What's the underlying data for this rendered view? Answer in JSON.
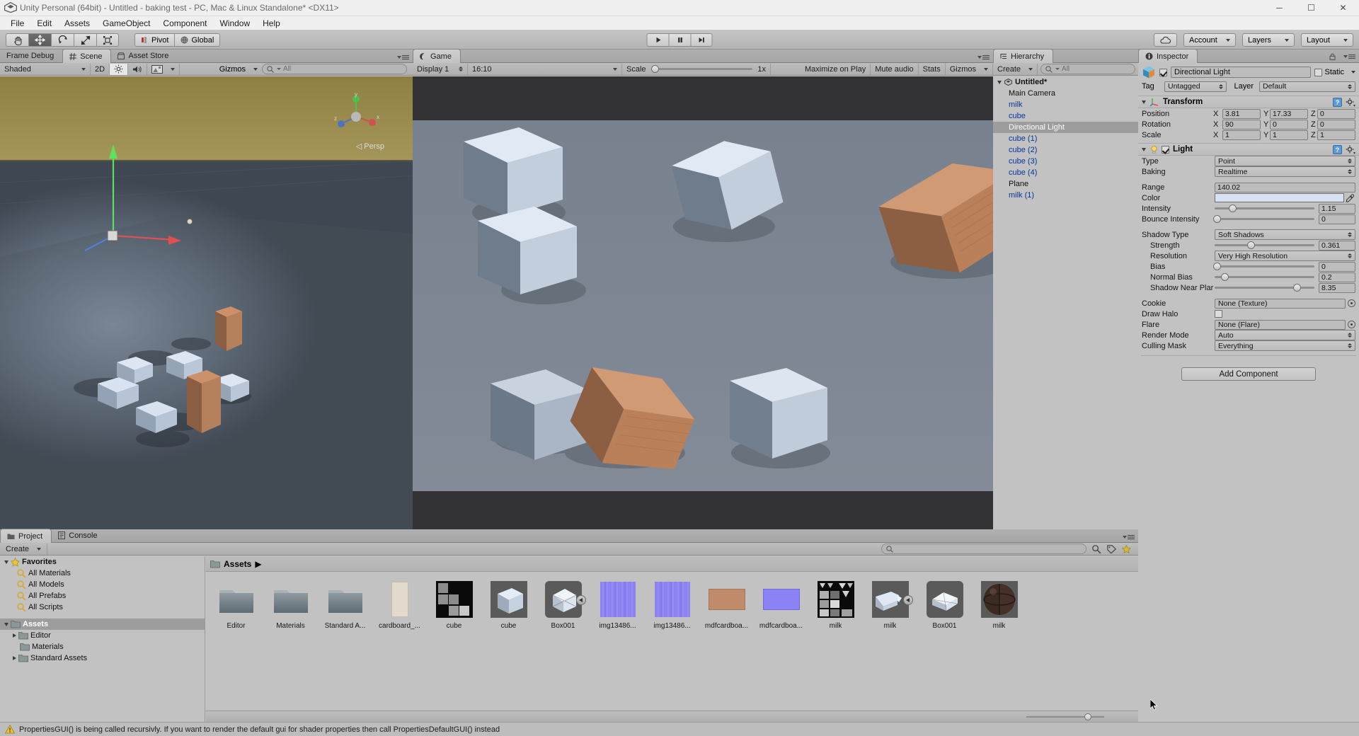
{
  "window": {
    "title": "Unity Personal (64bit) - Untitled - baking test - PC, Mac & Linux Standalone* <DX11>",
    "minimize": "─",
    "maximize": "☐",
    "close": "✕"
  },
  "menu": [
    "File",
    "Edit",
    "Assets",
    "GameObject",
    "Component",
    "Window",
    "Help"
  ],
  "toolbar": {
    "tools": [
      "hand-tool",
      "move-tool",
      "rotate-tool",
      "scale-tool",
      "rect-tool"
    ],
    "active_tool": "move-tool",
    "pivot_label": "Pivot",
    "global_label": "Global",
    "play_label": "play",
    "pause_label": "pause",
    "step_label": "step",
    "cloud_label": "cloud-icon",
    "account_label": "Account",
    "layers_label": "Layers",
    "layout_label": "Layout"
  },
  "scene_panel": {
    "tabs": [
      {
        "label": "Frame Debug",
        "active": false,
        "icon": ""
      },
      {
        "label": "Scene",
        "active": true,
        "icon": "grid-icon"
      },
      {
        "label": "Asset Store",
        "active": false,
        "icon": "store-icon"
      }
    ],
    "draw_mode": "Shaded",
    "two_d": "2D",
    "lighting_icon": "light-toggle-icon",
    "audio_icon": "audio-toggle-icon",
    "effects_icon": "effects-icon",
    "gizmos_label": "Gizmos",
    "search_placeholder": "All",
    "perspective_label": "Persp",
    "axis_labels": {
      "y": "y",
      "x": "x",
      "z": "z"
    }
  },
  "game_panel": {
    "tabs": [
      {
        "label": "Game",
        "active": true,
        "icon": "game-icon"
      }
    ],
    "display": "Display 1",
    "aspect": "16:10",
    "scale_label": "Scale",
    "scale_value": "1x",
    "maximize_label": "Maximize on Play",
    "mute_label": "Mute audio",
    "stats_label": "Stats",
    "gizmos_label": "Gizmos"
  },
  "hierarchy": {
    "tab_label": "Hierarchy",
    "create_label": "Create",
    "search_placeholder": "All",
    "scene_name": "Untitled*",
    "items": [
      {
        "label": "Main Camera",
        "type": "plain",
        "selected": false
      },
      {
        "label": "milk",
        "type": "prefab",
        "selected": false
      },
      {
        "label": "cube",
        "type": "prefab",
        "selected": false
      },
      {
        "label": "Directional Light",
        "type": "plain",
        "selected": true
      },
      {
        "label": "cube (1)",
        "type": "prefab",
        "selected": false
      },
      {
        "label": "cube (2)",
        "type": "prefab",
        "selected": false
      },
      {
        "label": "cube (3)",
        "type": "prefab",
        "selected": false
      },
      {
        "label": "cube (4)",
        "type": "prefab",
        "selected": false
      },
      {
        "label": "Plane",
        "type": "plain",
        "selected": false
      },
      {
        "label": "milk (1)",
        "type": "prefab",
        "selected": false
      }
    ]
  },
  "inspector": {
    "tab_label": "Inspector",
    "object_name": "Directional Light",
    "object_enabled": true,
    "static_label": "Static",
    "tag_label": "Tag",
    "tag_value": "Untagged",
    "layer_label": "Layer",
    "layer_value": "Default",
    "transform": {
      "title": "Transform",
      "position_label": "Position",
      "rotation_label": "Rotation",
      "scale_label": "Scale",
      "position": {
        "x": "3.81",
        "y": "17.33",
        "z": "0"
      },
      "rotation": {
        "x": "90",
        "y": "0",
        "z": "0"
      },
      "scale": {
        "x": "1",
        "y": "1",
        "z": "1"
      }
    },
    "light": {
      "title": "Light",
      "enabled": true,
      "type_label": "Type",
      "type_value": "Point",
      "baking_label": "Baking",
      "baking_value": "Realtime",
      "range_label": "Range",
      "range_value": "140.02",
      "color_label": "Color",
      "color_value": "#d8e0f4",
      "intensity_label": "Intensity",
      "intensity_value": "1.15",
      "intensity_pct": 18,
      "bounce_label": "Bounce Intensity",
      "bounce_value": "0",
      "bounce_pct": 2,
      "shadow_type_label": "Shadow Type",
      "shadow_type_value": "Soft Shadows",
      "strength_label": "Strength",
      "strength_value": "0.361",
      "strength_pct": 36,
      "resolution_label": "Resolution",
      "resolution_value": "Very High Resolution",
      "bias_label": "Bias",
      "bias_value": "0",
      "bias_pct": 2,
      "normal_bias_label": "Normal Bias",
      "normal_bias_value": "0.2",
      "normal_bias_pct": 10,
      "near_plane_label": "Shadow Near Plar",
      "near_plane_value": "8.35",
      "near_plane_pct": 82,
      "cookie_label": "Cookie",
      "cookie_value": "None (Texture)",
      "draw_halo_label": "Draw Halo",
      "draw_halo_checked": false,
      "flare_label": "Flare",
      "flare_value": "None (Flare)",
      "render_mode_label": "Render Mode",
      "render_mode_value": "Auto",
      "culling_label": "Culling Mask",
      "culling_value": "Everything"
    },
    "add_component_label": "Add Component"
  },
  "project": {
    "tabs": [
      {
        "label": "Project",
        "active": true,
        "icon": "folder-icon"
      },
      {
        "label": "Console",
        "active": false,
        "icon": "console-icon"
      }
    ],
    "create_label": "Create",
    "search_placeholder": "",
    "breadcrumb": "Assets",
    "tree": [
      {
        "label": "Favorites",
        "depth": 0,
        "bold": true,
        "arrow": "down",
        "icon": "star-icon",
        "selected": false
      },
      {
        "label": "All Materials",
        "depth": 1,
        "bold": false,
        "arrow": "none",
        "icon": "search-icon",
        "selected": false
      },
      {
        "label": "All Models",
        "depth": 1,
        "bold": false,
        "arrow": "none",
        "icon": "search-icon",
        "selected": false
      },
      {
        "label": "All Prefabs",
        "depth": 1,
        "bold": false,
        "arrow": "none",
        "icon": "search-icon",
        "selected": false
      },
      {
        "label": "All Scripts",
        "depth": 1,
        "bold": false,
        "arrow": "none",
        "icon": "search-icon",
        "selected": false
      },
      {
        "label": "Assets",
        "depth": 0,
        "bold": true,
        "arrow": "down",
        "icon": "folder-icon",
        "selected": true
      },
      {
        "label": "Editor",
        "depth": 1,
        "bold": false,
        "arrow": "right",
        "icon": "folder-icon",
        "selected": false
      },
      {
        "label": "Materials",
        "depth": 1,
        "bold": false,
        "arrow": "none",
        "icon": "folder-icon",
        "selected": false
      },
      {
        "label": "Standard Assets",
        "depth": 1,
        "bold": false,
        "arrow": "right",
        "icon": "folder-icon",
        "selected": false
      }
    ],
    "assets": [
      {
        "label": "Editor",
        "kind": "folder"
      },
      {
        "label": "Materials",
        "kind": "folder"
      },
      {
        "label": "Standard A...",
        "kind": "folder"
      },
      {
        "label": "cardboard_...",
        "kind": "texture-tall",
        "color": "#e2dbcc"
      },
      {
        "label": "cube",
        "kind": "lightmap",
        "color": "#0b0b0b"
      },
      {
        "label": "cube",
        "kind": "model",
        "color": "#5a5a5a"
      },
      {
        "label": "Box001",
        "kind": "prefab",
        "color": "#5a5a5a"
      },
      {
        "label": "img13486...",
        "kind": "normalmap",
        "color": "#8c82f0"
      },
      {
        "label": "img13486...",
        "kind": "normalmap",
        "color": "#8c82f0"
      },
      {
        "label": "mdfcardboa...",
        "kind": "texture-wide",
        "color": "#c08b6a"
      },
      {
        "label": "mdfcardboa...",
        "kind": "texture-wide",
        "color": "#8b83f5"
      },
      {
        "label": "milk",
        "kind": "lightmap2",
        "color": "#0b0b0b"
      },
      {
        "label": "milk",
        "kind": "model2",
        "color": "#5a5a5a"
      },
      {
        "label": "Box001",
        "kind": "prefab2",
        "color": "#5a5a5a"
      },
      {
        "label": "milk",
        "kind": "material-sphere",
        "color": "#3a2a22"
      }
    ]
  },
  "status": {
    "icon": "warning-icon",
    "message": "PropertiesGUI() is being called recursivly. If you want to render the default gui for shader properties then call PropertiesDefaultGUI() instead"
  }
}
